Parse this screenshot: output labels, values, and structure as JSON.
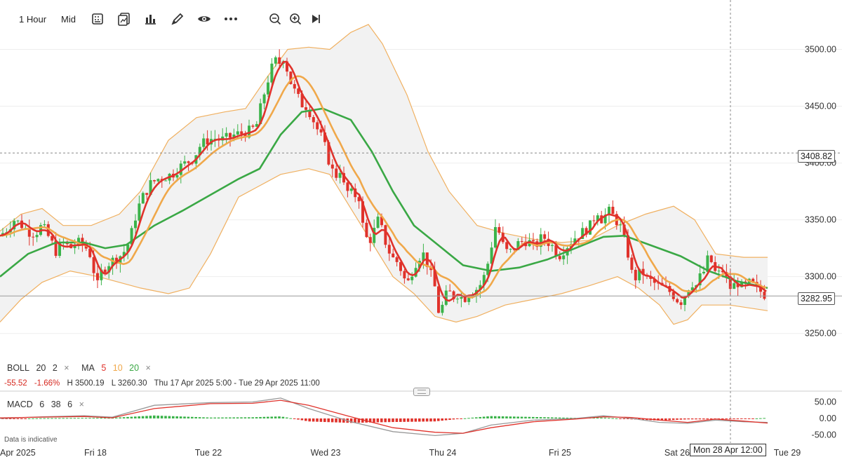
{
  "toolbar": {
    "interval": "1 Hour",
    "price_type": "Mid",
    "icons": [
      "chart-type-icon",
      "indicators-icon",
      "studies-icon",
      "draw-icon",
      "eye-icon",
      "more-icon",
      "zoom-out-icon",
      "zoom-in-icon",
      "scroll-to-latest-icon"
    ]
  },
  "indicators": {
    "boll_label": "BOLL",
    "boll_period": "20",
    "boll_std": "2",
    "ma_label": "MA",
    "ma_periods": [
      "5",
      "10",
      "20"
    ],
    "close_symbol": "×"
  },
  "info": {
    "change": "-55.52",
    "change_pct": "-1.66%",
    "high": "H 3500.19",
    "low": "L 3260.30",
    "range": "Thu 17 Apr 2025 5:00 - Tue 29 Apr 2025 11:00"
  },
  "macd": {
    "label": "MACD",
    "fast": "6",
    "slow": "38",
    "signal": "6",
    "close_symbol": "×"
  },
  "disclaimer": "Data is indicative",
  "price_labels": {
    "crosshair": "3408.82",
    "last": "3282.95"
  },
  "crosshair_date": "Mon 28 Apr 12:00",
  "colors": {
    "bull": "#3bb34a",
    "bear": "#e0322b",
    "ma5": "#e0322b",
    "ma10": "#f0a84a",
    "ma20": "#3aa845",
    "band": "#f0b060",
    "macd": "#999999",
    "signal": "#e0322b"
  },
  "chart_data": {
    "type": "candlestick",
    "y_ticks": [
      "3500.00",
      "3450.00",
      "3400.00",
      "3350.00",
      "3300.00",
      "3250.00"
    ],
    "x_ticks": [
      "Apr 2025",
      "Fri 18",
      "Tue 22",
      "Wed 23",
      "Thu 24",
      "Fri 25",
      "Sat 26",
      "Tue 29"
    ],
    "macd_ticks": [
      "50.00",
      "0.00",
      "-50.00"
    ],
    "ylim": [
      3235,
      3525
    ],
    "x_axis_range": [
      "Thu 17 Apr 2025 5:00",
      "Tue 29 Apr 2025 11:00"
    ],
    "close_path": [
      [
        0,
        3336
      ],
      [
        10,
        3342
      ],
      [
        20,
        3350
      ],
      [
        30,
        3346
      ],
      [
        40,
        3340
      ],
      [
        50,
        3338
      ],
      [
        60,
        3345
      ],
      [
        70,
        3334
      ],
      [
        80,
        3322
      ],
      [
        90,
        3330
      ],
      [
        100,
        3325
      ],
      [
        110,
        3330
      ],
      [
        120,
        3328
      ],
      [
        130,
        3318
      ],
      [
        138,
        3290
      ],
      [
        145,
        3305
      ],
      [
        155,
        3312
      ],
      [
        165,
        3316
      ],
      [
        175,
        3320
      ],
      [
        185,
        3332
      ],
      [
        195,
        3358
      ],
      [
        205,
        3372
      ],
      [
        215,
        3382
      ],
      [
        225,
        3386
      ],
      [
        235,
        3388
      ],
      [
        245,
        3390
      ],
      [
        255,
        3396
      ],
      [
        265,
        3400
      ],
      [
        275,
        3404
      ],
      [
        285,
        3415
      ],
      [
        295,
        3420
      ],
      [
        305,
        3422
      ],
      [
        315,
        3420
      ],
      [
        325,
        3422
      ],
      [
        335,
        3425
      ],
      [
        345,
        3426
      ],
      [
        355,
        3428
      ],
      [
        365,
        3432
      ],
      [
        372,
        3450
      ],
      [
        378,
        3465
      ],
      [
        385,
        3480
      ],
      [
        392,
        3490
      ],
      [
        398,
        3488
      ],
      [
        405,
        3495
      ],
      [
        410,
        3480
      ],
      [
        415,
        3470
      ],
      [
        422,
        3460
      ],
      [
        430,
        3452
      ],
      [
        438,
        3450
      ],
      [
        445,
        3440
      ],
      [
        452,
        3430
      ],
      [
        460,
        3420
      ],
      [
        466,
        3408
      ],
      [
        472,
        3395
      ],
      [
        478,
        3388
      ],
      [
        485,
        3395
      ],
      [
        490,
        3380
      ],
      [
        496,
        3374
      ],
      [
        505,
        3372
      ],
      [
        512,
        3370
      ],
      [
        518,
        3340
      ],
      [
        525,
        3330
      ],
      [
        532,
        3338
      ],
      [
        538,
        3350
      ],
      [
        545,
        3340
      ],
      [
        552,
        3325
      ],
      [
        560,
        3316
      ],
      [
        568,
        3312
      ],
      [
        575,
        3300
      ],
      [
        580,
        3292
      ],
      [
        590,
        3310
      ],
      [
        598,
        3318
      ],
      [
        605,
        3320
      ],
      [
        612,
        3305
      ],
      [
        620,
        3290
      ],
      [
        625,
        3270
      ],
      [
        632,
        3275
      ],
      [
        638,
        3288
      ],
      [
        645,
        3282
      ],
      [
        652,
        3285
      ],
      [
        660,
        3280
      ],
      [
        668,
        3285
      ],
      [
        675,
        3288
      ],
      [
        682,
        3290
      ],
      [
        690,
        3300
      ],
      [
        698,
        3318
      ],
      [
        705,
        3345
      ],
      [
        712,
        3338
      ],
      [
        718,
        3325
      ],
      [
        725,
        3320
      ],
      [
        732,
        3325
      ],
      [
        740,
        3330
      ],
      [
        748,
        3332
      ],
      [
        755,
        3330
      ],
      [
        762,
        3325
      ],
      [
        768,
        3332
      ],
      [
        775,
        3335
      ],
      [
        782,
        3330
      ],
      [
        790,
        3325
      ],
      [
        796,
        3318
      ],
      [
        805,
        3325
      ],
      [
        812,
        3330
      ],
      [
        820,
        3335
      ],
      [
        828,
        3338
      ],
      [
        836,
        3342
      ],
      [
        844,
        3346
      ],
      [
        850,
        3360
      ],
      [
        858,
        3350
      ],
      [
        864,
        3355
      ],
      [
        870,
        3358
      ],
      [
        876,
        3350
      ],
      [
        882,
        3348
      ],
      [
        888,
        3335
      ],
      [
        895,
        3320
      ],
      [
        902,
        3298
      ],
      [
        908,
        3300
      ],
      [
        915,
        3305
      ],
      [
        922,
        3298
      ],
      [
        930,
        3295
      ],
      [
        938,
        3292
      ],
      [
        945,
        3290
      ],
      [
        952,
        3288
      ],
      [
        958,
        3285
      ],
      [
        965,
        3280
      ],
      [
        972,
        3278
      ],
      [
        980,
        3290
      ],
      [
        986,
        3295
      ],
      [
        992,
        3292
      ],
      [
        998,
        3300
      ],
      [
        1004,
        3305
      ],
      [
        1010,
        3318
      ],
      [
        1016,
        3310
      ],
      [
        1022,
        3298
      ],
      [
        1028,
        3308
      ],
      [
        1034,
        3300
      ],
      [
        1040,
        3290
      ],
      [
        1046,
        3292
      ],
      [
        1052,
        3295
      ],
      [
        1058,
        3290
      ],
      [
        1064,
        3292
      ],
      [
        1070,
        3295
      ],
      [
        1076,
        3290
      ],
      [
        1082,
        3288
      ],
      [
        1088,
        3285
      ],
      [
        1094,
        3282.95
      ]
    ],
    "ma20_path": [
      [
        0,
        3300
      ],
      [
        40,
        3320
      ],
      [
        80,
        3330
      ],
      [
        120,
        3330
      ],
      [
        150,
        3325
      ],
      [
        180,
        3328
      ],
      [
        220,
        3345
      ],
      [
        260,
        3358
      ],
      [
        300,
        3372
      ],
      [
        340,
        3386
      ],
      [
        370,
        3395
      ],
      [
        400,
        3425
      ],
      [
        430,
        3445
      ],
      [
        460,
        3448
      ],
      [
        500,
        3438
      ],
      [
        530,
        3410
      ],
      [
        560,
        3375
      ],
      [
        590,
        3345
      ],
      [
        620,
        3330
      ],
      [
        660,
        3310
      ],
      [
        700,
        3305
      ],
      [
        740,
        3308
      ],
      [
        780,
        3315
      ],
      [
        820,
        3325
      ],
      [
        860,
        3335
      ],
      [
        890,
        3336
      ],
      [
        930,
        3327
      ],
      [
        970,
        3318
      ],
      [
        1010,
        3305
      ],
      [
        1050,
        3296
      ],
      [
        1094,
        3290
      ]
    ],
    "upper_band_path": [
      [
        0,
        3340
      ],
      [
        30,
        3355
      ],
      [
        60,
        3360
      ],
      [
        90,
        3345
      ],
      [
        130,
        3345
      ],
      [
        170,
        3355
      ],
      [
        200,
        3375
      ],
      [
        240,
        3420
      ],
      [
        280,
        3440
      ],
      [
        320,
        3445
      ],
      [
        350,
        3448
      ],
      [
        380,
        3475
      ],
      [
        410,
        3500
      ],
      [
        440,
        3502
      ],
      [
        470,
        3500
      ],
      [
        500,
        3515
      ],
      [
        525,
        3522
      ],
      [
        545,
        3505
      ],
      [
        580,
        3460
      ],
      [
        610,
        3410
      ],
      [
        640,
        3375
      ],
      [
        680,
        3345
      ],
      [
        720,
        3338
      ],
      [
        760,
        3333
      ],
      [
        800,
        3330
      ],
      [
        840,
        3332
      ],
      [
        880,
        3345
      ],
      [
        920,
        3355
      ],
      [
        960,
        3362
      ],
      [
        990,
        3350
      ],
      [
        1020,
        3320
      ],
      [
        1060,
        3317
      ],
      [
        1094,
        3317
      ]
    ],
    "lower_band_path": [
      [
        0,
        3260
      ],
      [
        30,
        3280
      ],
      [
        60,
        3295
      ],
      [
        100,
        3305
      ],
      [
        140,
        3300
      ],
      [
        170,
        3295
      ],
      [
        200,
        3290
      ],
      [
        240,
        3285
      ],
      [
        270,
        3290
      ],
      [
        300,
        3320
      ],
      [
        340,
        3370
      ],
      [
        370,
        3380
      ],
      [
        400,
        3390
      ],
      [
        440,
        3395
      ],
      [
        470,
        3390
      ],
      [
        500,
        3360
      ],
      [
        530,
        3330
      ],
      [
        560,
        3300
      ],
      [
        590,
        3285
      ],
      [
        620,
        3265
      ],
      [
        650,
        3260
      ],
      [
        680,
        3265
      ],
      [
        720,
        3275
      ],
      [
        760,
        3280
      ],
      [
        800,
        3285
      ],
      [
        840,
        3292
      ],
      [
        880,
        3300
      ],
      [
        910,
        3290
      ],
      [
        940,
        3275
      ],
      [
        960,
        3258
      ],
      [
        980,
        3262
      ],
      [
        1000,
        3275
      ],
      [
        1040,
        3275
      ],
      [
        1094,
        3270
      ]
    ],
    "macd_path": [
      [
        0,
        0
      ],
      [
        60,
        5
      ],
      [
        120,
        8
      ],
      [
        160,
        4
      ],
      [
        220,
        40
      ],
      [
        300,
        48
      ],
      [
        360,
        50
      ],
      [
        400,
        62
      ],
      [
        440,
        30
      ],
      [
        500,
        -10
      ],
      [
        560,
        -40
      ],
      [
        620,
        -52
      ],
      [
        660,
        -45
      ],
      [
        700,
        -20
      ],
      [
        760,
        -5
      ],
      [
        820,
        0
      ],
      [
        860,
        8
      ],
      [
        900,
        0
      ],
      [
        940,
        -12
      ],
      [
        980,
        -15
      ],
      [
        1020,
        -5
      ],
      [
        1060,
        -10
      ],
      [
        1094,
        -12
      ]
    ],
    "signal_path": [
      [
        0,
        2
      ],
      [
        60,
        4
      ],
      [
        120,
        6
      ],
      [
        160,
        2
      ],
      [
        220,
        30
      ],
      [
        300,
        45
      ],
      [
        360,
        46
      ],
      [
        400,
        55
      ],
      [
        440,
        40
      ],
      [
        500,
        5
      ],
      [
        560,
        -28
      ],
      [
        620,
        -42
      ],
      [
        660,
        -45
      ],
      [
        700,
        -28
      ],
      [
        760,
        -10
      ],
      [
        820,
        -2
      ],
      [
        860,
        5
      ],
      [
        900,
        3
      ],
      [
        940,
        -5
      ],
      [
        980,
        -12
      ],
      [
        1020,
        -2
      ],
      [
        1060,
        -8
      ],
      [
        1094,
        -14
      ]
    ]
  }
}
